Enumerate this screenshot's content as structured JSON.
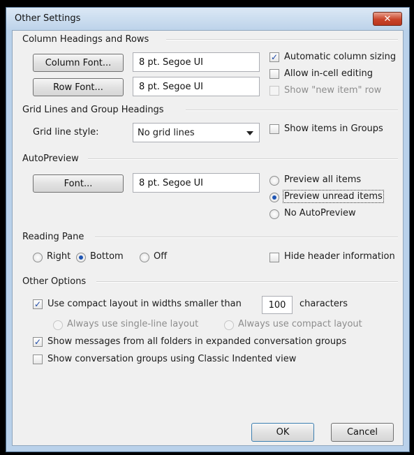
{
  "window": {
    "title": "Other Settings",
    "close_glyph": "✕"
  },
  "column_headings": {
    "section_label": "Column Headings and Rows",
    "column_font_button": "Column Font...",
    "column_font_value": "8 pt. Segoe UI",
    "row_font_button": "Row Font...",
    "row_font_value": "8 pt. Segoe UI",
    "automatic_column_sizing": {
      "label": "Automatic column sizing",
      "checked": true
    },
    "allow_incell_editing": {
      "label": "Allow in-cell editing",
      "checked": false
    },
    "show_new_item_row": {
      "label": "Show \"new item\" row",
      "checked": false,
      "disabled": true
    }
  },
  "grid_lines": {
    "section_label": "Grid Lines and Group Headings",
    "grid_line_style_label": "Grid line style:",
    "grid_line_style_value": "No grid lines",
    "show_items_in_groups": {
      "label": "Show items in Groups",
      "checked": false
    }
  },
  "autopreview": {
    "section_label": "AutoPreview",
    "font_button": "Font...",
    "font_value": "8 pt. Segoe UI",
    "options": [
      {
        "label": "Preview all items",
        "selected": false
      },
      {
        "label": "Preview unread items",
        "selected": true
      },
      {
        "label": "No AutoPreview",
        "selected": false
      }
    ]
  },
  "reading_pane": {
    "section_label": "Reading Pane",
    "options": [
      {
        "label": "Right",
        "selected": false
      },
      {
        "label": "Bottom",
        "selected": true
      },
      {
        "label": "Off",
        "selected": false
      }
    ],
    "hide_header_information": {
      "label": "Hide header information",
      "checked": false
    }
  },
  "other_options": {
    "section_label": "Other Options",
    "compact_layout": {
      "label": "Use compact layout in widths smaller than",
      "checked": true,
      "value": "100",
      "suffix": "characters"
    },
    "single_line_layout": {
      "label": "Always use single-line layout",
      "disabled": true
    },
    "always_compact_layout": {
      "label": "Always use compact layout",
      "disabled": true
    },
    "show_messages_all_folders": {
      "label": "Show messages from all folders in expanded conversation groups",
      "checked": true
    },
    "classic_indented_view": {
      "label": "Show conversation groups using Classic Indented view",
      "checked": false
    }
  },
  "buttons": {
    "ok": "OK",
    "cancel": "Cancel"
  },
  "colors": {
    "title_bar": "#bdd3ea",
    "close_button": "#c9442a",
    "dialog_bg": "#f0f0f0",
    "selection_dot": "#1f55b3"
  }
}
